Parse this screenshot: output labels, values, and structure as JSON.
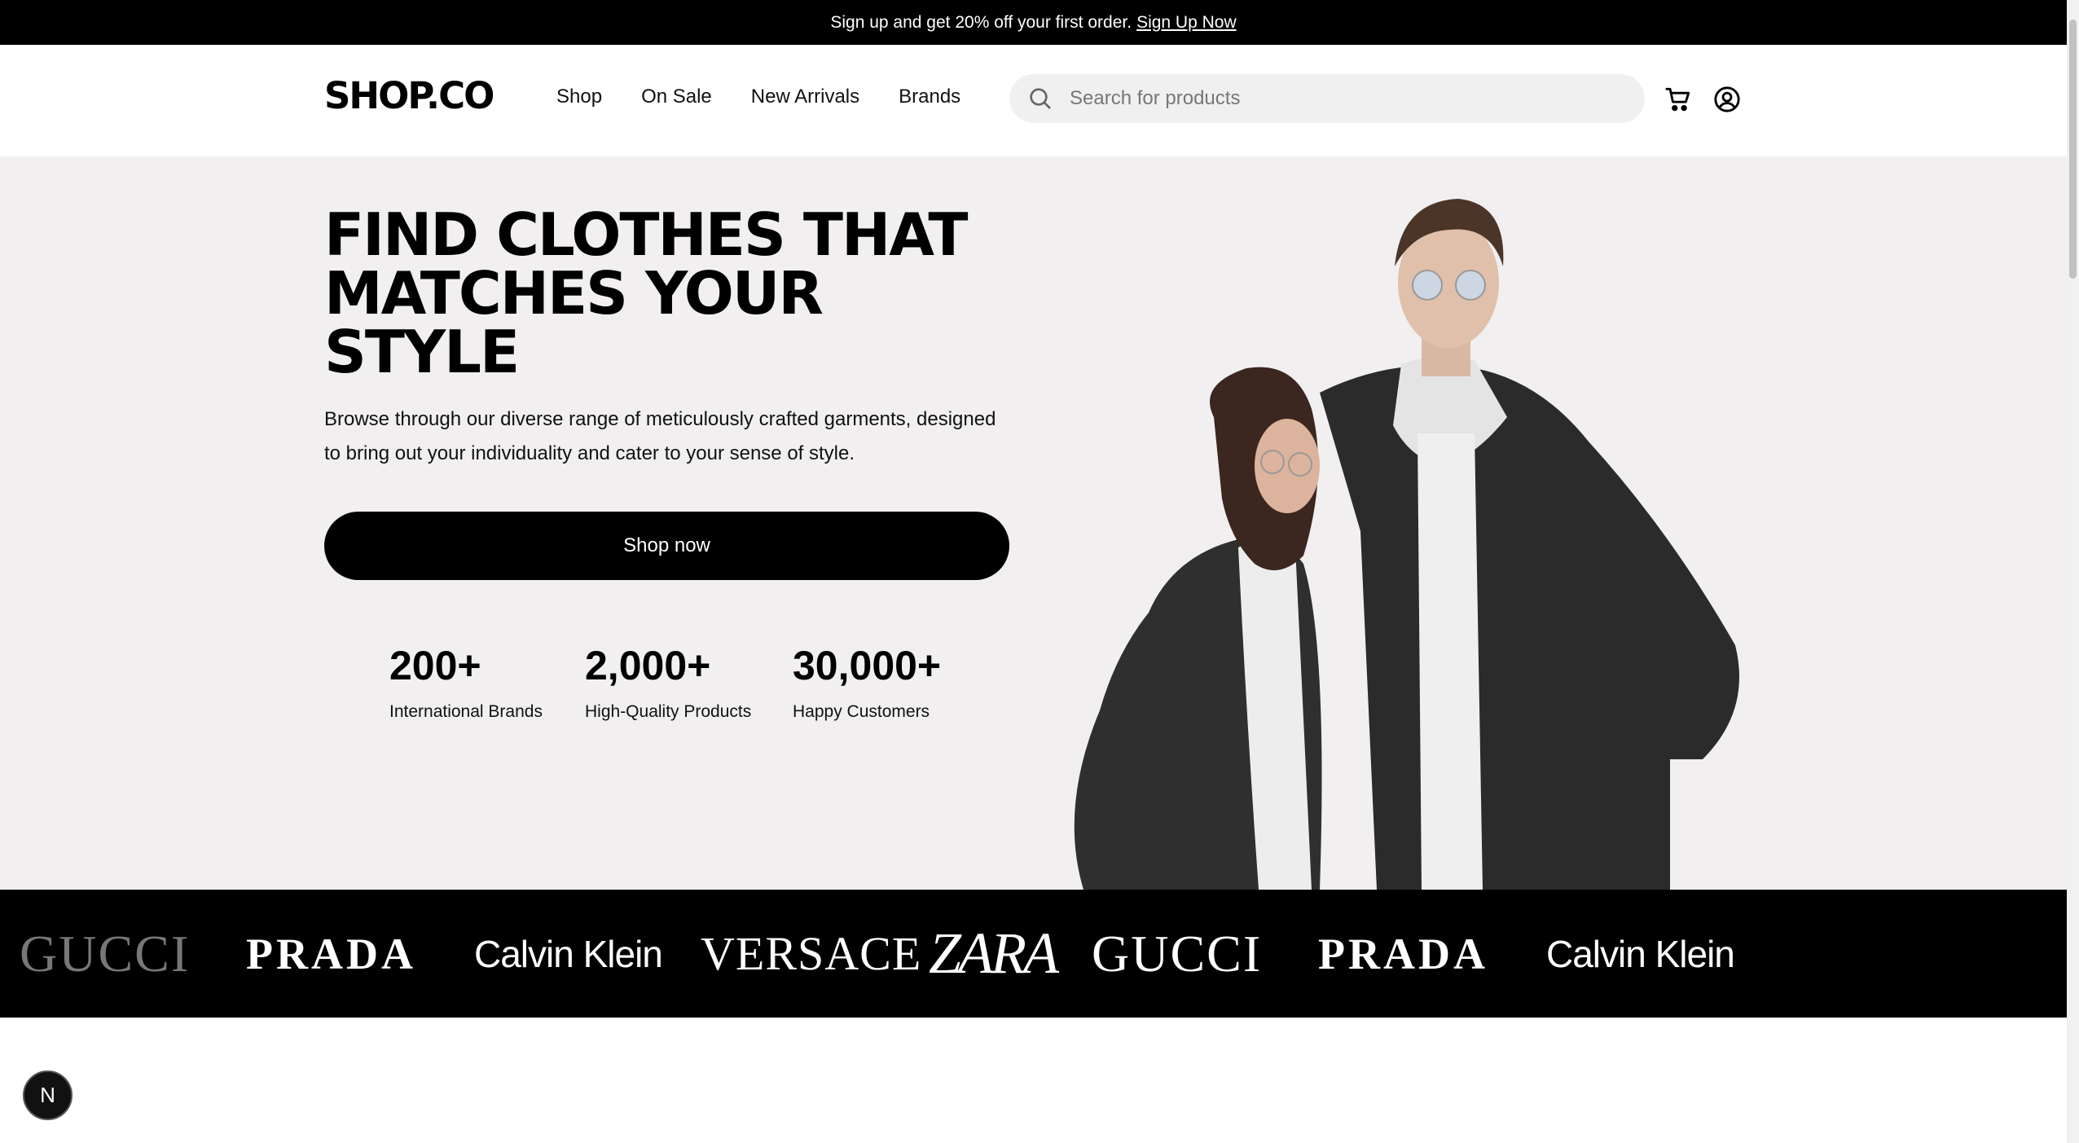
{
  "promo": {
    "text": "Sign up and get 20% off your first order.",
    "link": "Sign Up Now"
  },
  "header": {
    "logo": "SHOP.CO",
    "nav": [
      "Shop",
      "On Sale",
      "New Arrivals",
      "Brands"
    ],
    "search_placeholder": "Search for products",
    "icons": [
      "search-icon",
      "cart-icon",
      "account-icon"
    ]
  },
  "hero": {
    "headline_lines": [
      "FIND CLOTHES THAT",
      "MATCHES YOUR",
      "STYLE"
    ],
    "subtext": "Browse through our diverse range of meticulously crafted garments, designed to bring out your individuality and cater to your sense of style.",
    "cta": "Shop now",
    "stats": [
      {
        "value": "200+",
        "label": "International Brands"
      },
      {
        "value": "2,000+",
        "label": "High-Quality Products"
      },
      {
        "value": "30,000+",
        "label": "Happy Customers"
      }
    ]
  },
  "brands": [
    "GUCCI",
    "PRADA",
    "Calvin Klein",
    "VERSACE",
    "ZARA",
    "GUCCI",
    "PRADA",
    "Calvin Klein"
  ],
  "badge": "N",
  "colors": {
    "promo_bg": "#000000",
    "hero_bg": "#F1EFF0",
    "search_bg": "#F0F0F0",
    "brand_bar_bg": "#000000",
    "button_bg": "#000000"
  }
}
